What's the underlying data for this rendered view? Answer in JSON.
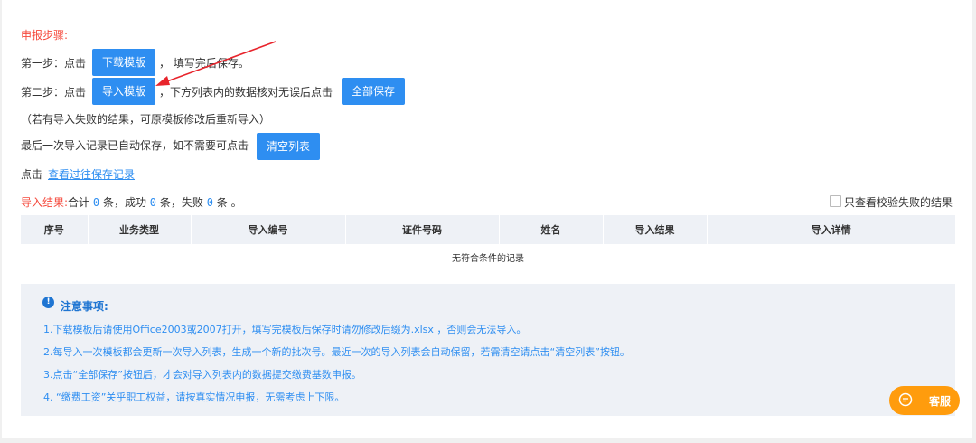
{
  "steps": {
    "heading": "申报步骤:",
    "step1_prefix": "第一步：点击",
    "download_btn": "下载模版",
    "step1_suffix": "，  填写完后保存。",
    "step2_prefix": "第二步：点击",
    "import_btn": "导入模版",
    "step2_suffix": "，下方列表内的数据核对无误后点击",
    "save_all_btn": "全部保存",
    "note_line": "（若有导入失败的结果，可原模板修改后重新导入）",
    "auto_save_text": "最后一次导入记录已自动保存，如不需要可点击",
    "clear_btn": "清空列表",
    "click_text": "点击",
    "history_link": "查看过往保存记录"
  },
  "result": {
    "label": "导入结果:",
    "total_text": "合计",
    "total": "0",
    "unit1": "条，成功",
    "success": "0",
    "unit2": "条，失败",
    "fail": "0",
    "unit3": "条 。",
    "checkbox_label": "只查看校验失败的结果",
    "checkbox_checked": false
  },
  "table": {
    "columns": [
      "序号",
      "业务类型",
      "导入编号",
      "证件号码",
      "姓名",
      "导入结果",
      "导入详情"
    ],
    "empty_text": "无符合条件的记录"
  },
  "notice": {
    "title": "注意事项:",
    "lines": [
      "1.下载模板后请使用Office2003或2007打开，填写完模板后保存时请勿修改后缀为.xlsx ，否则会无法导入。",
      "2.每导入一次模板都会更新一次导入列表，生成一个新的批次号。最近一次的导入列表会自动保留，若需清空请点击“清空列表”按钮。",
      "3.点击“全部保存”按钮后，才会对导入列表内的数据提交缴费基数申报。",
      "4. “缴费工资”关乎职工权益，请按真实情况申报，无需考虑上下限。"
    ]
  },
  "support": {
    "label": "客服"
  },
  "colors": {
    "accent": "#2e8ef1",
    "heading_red": "#f5483b",
    "support_orange": "#ff9c0d",
    "arrow_red": "#e8242c"
  }
}
